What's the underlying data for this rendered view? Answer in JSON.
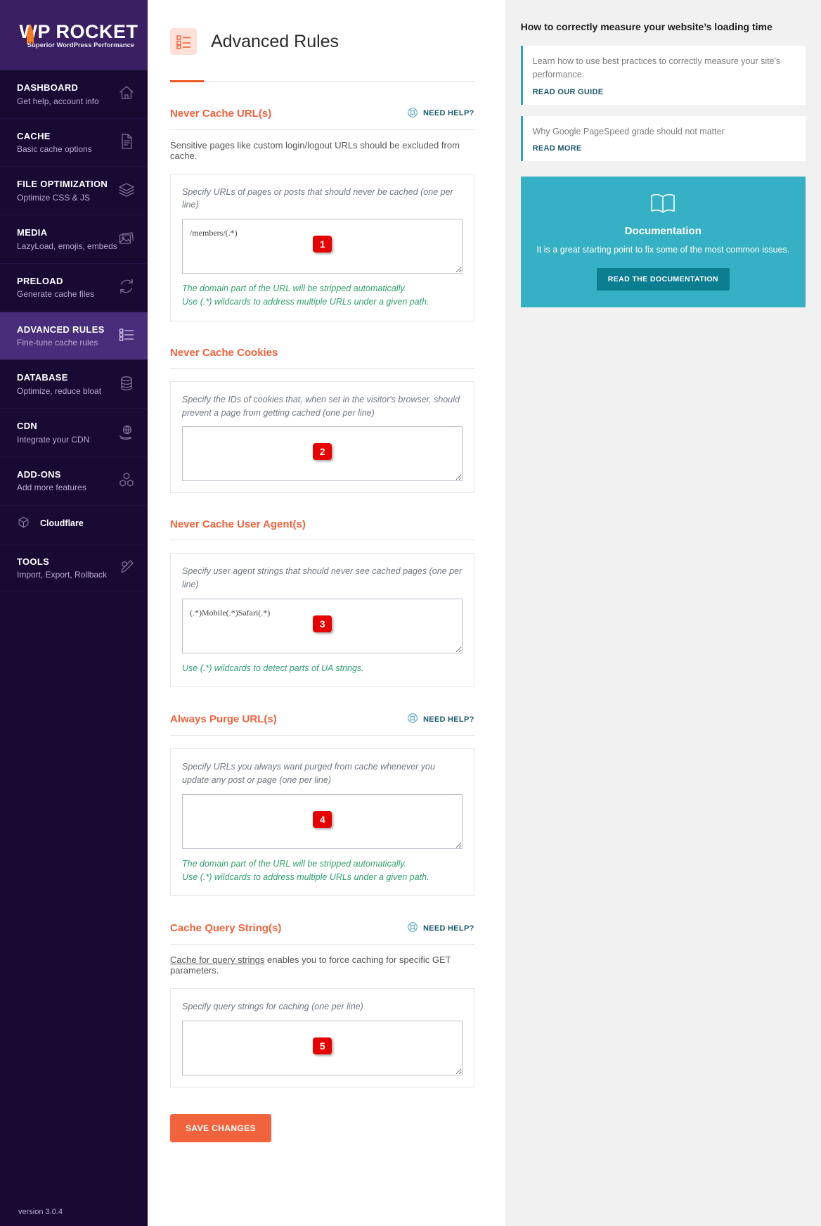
{
  "brand": {
    "name": "WP ROCKET",
    "tagline": "Superior WordPress Performance",
    "version": "version 3.0.4"
  },
  "sidebar": {
    "items": [
      {
        "title": "DASHBOARD",
        "subtitle": "Get help, account info",
        "icon": "home-icon",
        "active": false
      },
      {
        "title": "CACHE",
        "subtitle": "Basic cache options",
        "icon": "document-icon",
        "active": false
      },
      {
        "title": "FILE OPTIMIZATION",
        "subtitle": "Optimize CSS & JS",
        "icon": "layers-icon",
        "active": false
      },
      {
        "title": "MEDIA",
        "subtitle": "LazyLoad, emojis, embeds",
        "icon": "photos-icon",
        "active": false
      },
      {
        "title": "PRELOAD",
        "subtitle": "Generate cache files",
        "icon": "refresh-icon",
        "active": false
      },
      {
        "title": "ADVANCED RULES",
        "subtitle": "Fine-tune cache rules",
        "icon": "checklist-icon",
        "active": true
      },
      {
        "title": "DATABASE",
        "subtitle": "Optimize, reduce bloat",
        "icon": "database-icon",
        "active": false
      },
      {
        "title": "CDN",
        "subtitle": "Integrate your CDN",
        "icon": "cdn-globe-icon",
        "active": false
      },
      {
        "title": "ADD-ONS",
        "subtitle": "Add more features",
        "icon": "blocks-icon",
        "active": false
      }
    ],
    "subitem": {
      "label": "Cloudflare",
      "icon": "cube-icon"
    },
    "tools": {
      "title": "TOOLS",
      "subtitle": "Import, Export, Rollback",
      "icon": "tools-icon"
    }
  },
  "header": {
    "title": "Advanced Rules",
    "icon": "checklist-icon"
  },
  "common": {
    "need_help": "NEED HELP?",
    "help_icon": "lifebuoy-icon"
  },
  "sections": [
    {
      "id": "never-cache-urls",
      "title": "Never Cache URL(s)",
      "has_help": true,
      "description": "Sensitive pages like custom login/logout URLs should be excluded from cache.",
      "field_label": "Specify URLs of pages or posts that should never be cached (one per line)",
      "value": "/members/(.*)",
      "badge": "1",
      "notes": [
        "The domain part of the URL will be stripped automatically.",
        "Use (.*) wildcards to address multiple URLs under a given path."
      ]
    },
    {
      "id": "never-cache-cookies",
      "title": "Never Cache Cookies",
      "has_help": false,
      "description": "",
      "field_label": "Specify the IDs of cookies that, when set in the visitor's browser, should prevent a page from getting cached (one per line)",
      "value": "",
      "badge": "2",
      "notes": []
    },
    {
      "id": "never-cache-user-agents",
      "title": "Never Cache User Agent(s)",
      "has_help": false,
      "description": "",
      "field_label": "Specify user agent strings that should never see cached pages (one per line)",
      "value": "(.*)Mobile(.*)Safari(.*)",
      "badge": "3",
      "notes": [
        "Use (.*) wildcards to detect parts of UA strings."
      ]
    },
    {
      "id": "always-purge-urls",
      "title": "Always Purge URL(s)",
      "has_help": true,
      "description": "",
      "field_label": "Specify URLs you always want purged from cache whenever you update any post or page (one per line)",
      "value": "",
      "badge": "4",
      "notes": [
        "The domain part of the URL will be stripped automatically.",
        "Use (.*) wildcards to address multiple URLs under a given path."
      ]
    },
    {
      "id": "cache-query-strings",
      "title": "Cache Query String(s)",
      "has_help": true,
      "description_link": "Cache for query strings",
      "description_rest": " enables you to force caching for specific GET parameters.",
      "field_label": "Specify query strings for caching (one per line)",
      "value": "",
      "badge": "5",
      "notes": []
    }
  ],
  "save_button": "SAVE CHANGES",
  "right_panel": {
    "title": "How to correctly measure your website’s loading time",
    "cards": [
      {
        "text": "Learn how to use best practices to correctly measure your site's performance.",
        "link": "READ OUR GUIDE"
      },
      {
        "text": "Why Google PageSpeed grade should not matter",
        "link": "READ MORE"
      }
    ],
    "doc": {
      "icon": "book-icon",
      "title": "Documentation",
      "text": "It is a great starting point to fix some of the most common issues.",
      "button": "READ THE DOCUMENTATION"
    }
  },
  "colors": {
    "brand_purple": "#190a33",
    "accent_orange": "#f0633c",
    "teal": "#36b0c4",
    "badge_red": "#e60000",
    "green_note": "#2f9e6e"
  }
}
